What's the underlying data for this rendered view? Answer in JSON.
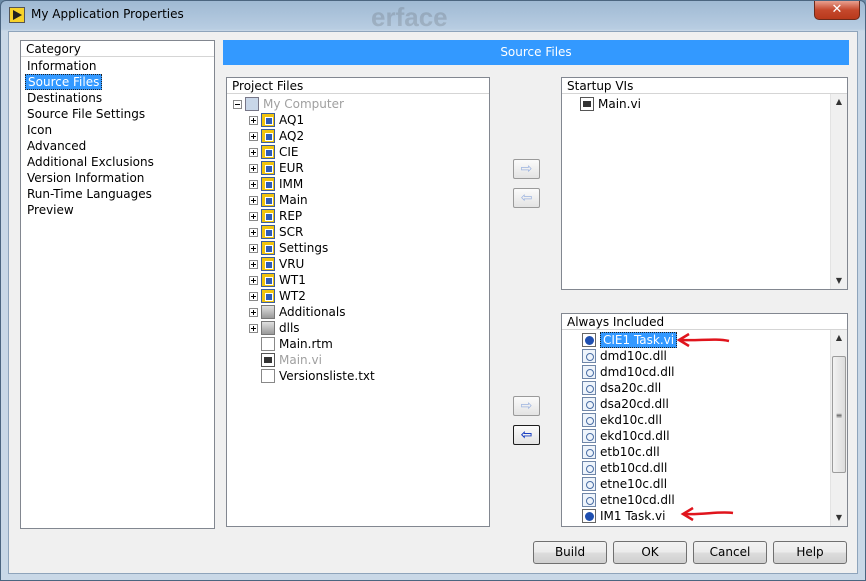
{
  "window": {
    "title": "My Application Properties",
    "ghost_text": "erface",
    "close_label": "✕",
    "icon": "labview-app-icon"
  },
  "category": {
    "header": "Category",
    "items": [
      {
        "label": "Information",
        "selected": false
      },
      {
        "label": "Source Files",
        "selected": true
      },
      {
        "label": "Destinations",
        "selected": false
      },
      {
        "label": "Source File Settings",
        "selected": false
      },
      {
        "label": "Icon",
        "selected": false
      },
      {
        "label": "Advanced",
        "selected": false
      },
      {
        "label": "Additional Exclusions",
        "selected": false
      },
      {
        "label": "Version Information",
        "selected": false
      },
      {
        "label": "Run-Time Languages",
        "selected": false
      },
      {
        "label": "Preview",
        "selected": false
      }
    ]
  },
  "section_title": "Source Files",
  "project_files": {
    "header": "Project Files",
    "root": {
      "label": "My Computer",
      "icon": "computer-icon"
    },
    "items": [
      {
        "label": "AQ1",
        "icon": "library-icon",
        "expandable": true
      },
      {
        "label": "AQ2",
        "icon": "library-icon",
        "expandable": true
      },
      {
        "label": "CIE",
        "icon": "library-icon",
        "expandable": true
      },
      {
        "label": "EUR",
        "icon": "library-icon",
        "expandable": true
      },
      {
        "label": "IMM",
        "icon": "library-icon",
        "expandable": true
      },
      {
        "label": "Main",
        "icon": "library-icon",
        "expandable": true
      },
      {
        "label": "REP",
        "icon": "library-icon",
        "expandable": true
      },
      {
        "label": "SCR",
        "icon": "library-icon",
        "expandable": true
      },
      {
        "label": "Settings",
        "icon": "library-icon",
        "expandable": true
      },
      {
        "label": "VRU",
        "icon": "library-icon",
        "expandable": true
      },
      {
        "label": "WT1",
        "icon": "library-icon",
        "expandable": true
      },
      {
        "label": "WT2",
        "icon": "library-icon",
        "expandable": true
      },
      {
        "label": "Additionals",
        "icon": "folder-icon",
        "expandable": true
      },
      {
        "label": "dlls",
        "icon": "folder-icon",
        "expandable": true
      },
      {
        "label": "Main.rtm",
        "icon": "rtm-file-icon",
        "expandable": false
      },
      {
        "label": "Main.vi",
        "icon": "vi-icon",
        "expandable": false,
        "disabled": true
      },
      {
        "label": "Versionsliste.txt",
        "icon": "text-file-icon",
        "expandable": false
      }
    ]
  },
  "startup_vis": {
    "header": "Startup VIs",
    "items": [
      {
        "label": "Main.vi",
        "icon": "vi-icon"
      }
    ]
  },
  "always_included": {
    "header": "Always Included",
    "items": [
      {
        "label": "CIE1 Task.vi",
        "icon": "vi-icon",
        "selected": true
      },
      {
        "label": "dmd10c.dll",
        "icon": "dll-icon"
      },
      {
        "label": "dmd10cd.dll",
        "icon": "dll-icon"
      },
      {
        "label": "dsa20c.dll",
        "icon": "dll-icon"
      },
      {
        "label": "dsa20cd.dll",
        "icon": "dll-icon"
      },
      {
        "label": "ekd10c.dll",
        "icon": "dll-icon"
      },
      {
        "label": "ekd10cd.dll",
        "icon": "dll-icon"
      },
      {
        "label": "etb10c.dll",
        "icon": "dll-icon"
      },
      {
        "label": "etb10cd.dll",
        "icon": "dll-icon"
      },
      {
        "label": "etne10c.dll",
        "icon": "dll-icon"
      },
      {
        "label": "etne10cd.dll",
        "icon": "dll-icon"
      },
      {
        "label": "IM1 Task.vi",
        "icon": "vi-icon"
      }
    ]
  },
  "transfer_buttons": {
    "startup_add": "⇨",
    "startup_remove": "⇦",
    "included_add": "⇨",
    "included_remove": "⇦"
  },
  "footer": {
    "build": "Build",
    "ok": "OK",
    "cancel": "Cancel",
    "help": "Help"
  },
  "colors": {
    "selection": "#3399ff",
    "annotation_arrow": "#e0141c"
  }
}
